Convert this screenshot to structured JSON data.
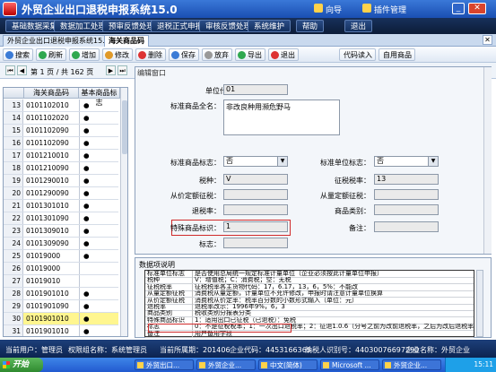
{
  "app": {
    "title": "外贸企业出口退税申报系统15.0",
    "wizard_label": "向导",
    "plugin_label": "插件管理"
  },
  "menu": [
    "基础数据采集",
    "数据加工处理",
    "预审反馈处理",
    "退税正式申报",
    "审核反馈处理",
    "系统维护",
    "帮助",
    "退出"
  ],
  "doc_tabs": {
    "first": "外贸企业出口退税申报系统15.0",
    "active": "海关商品码"
  },
  "toolbar": [
    "搜索",
    "刷新",
    "增加",
    "修改",
    "删除",
    "保存",
    "放弃",
    "导出",
    "退出",
    "代码读入",
    "自用商品"
  ],
  "pager": {
    "page_text": "第 1 页 / 共 162 页"
  },
  "grid": {
    "headers": [
      "海关商品码",
      "基本商品标志"
    ],
    "rows": [
      {
        "n": "13",
        "code": "0101102010",
        "flag": "●"
      },
      {
        "n": "14",
        "code": "0101102020",
        "flag": "●"
      },
      {
        "n": "15",
        "code": "0101102090",
        "flag": "●"
      },
      {
        "n": "16",
        "code": "0101102090",
        "flag": "●"
      },
      {
        "n": "17",
        "code": "0101210010",
        "flag": "●"
      },
      {
        "n": "18",
        "code": "0101210090",
        "flag": "●"
      },
      {
        "n": "19",
        "code": "0101290010",
        "flag": "●"
      },
      {
        "n": "20",
        "code": "0101290090",
        "flag": "●"
      },
      {
        "n": "21",
        "code": "0101301010",
        "flag": "●"
      },
      {
        "n": "22",
        "code": "0101301090",
        "flag": "●"
      },
      {
        "n": "23",
        "code": "0101309010",
        "flag": "●"
      },
      {
        "n": "24",
        "code": "0101309090",
        "flag": "●"
      },
      {
        "n": "25",
        "code": "01019000",
        "flag": "●"
      },
      {
        "n": "26",
        "code": "01019000",
        "flag": ""
      },
      {
        "n": "27",
        "code": "01019010",
        "flag": ""
      },
      {
        "n": "28",
        "code": "0101901010",
        "flag": "●"
      },
      {
        "n": "29",
        "code": "0101901090",
        "flag": "●"
      },
      {
        "n": "30",
        "code": "0101901010",
        "flag": "●"
      },
      {
        "n": "31",
        "code": "0101901010",
        "flag": "●"
      },
      {
        "n": "32",
        "code": "0101901090",
        "flag": "●"
      }
    ],
    "selected_row": "30"
  },
  "edit": {
    "title": "编辑窗口",
    "unit_code_label": "单位代码：",
    "unit_code": "01",
    "std_name_label": "标准商品全名：",
    "std_name": "非改良种用濒危野马",
    "std_flag_label": "标准商品标志：",
    "std_flag": "否",
    "std_unit_flag_label": "标准单位标志：",
    "std_unit_flag": "否",
    "tax_type_label": "税种：",
    "tax_type": "V",
    "levy_rate_label": "征税税率：",
    "levy_rate": "13",
    "ad_valorem_label": "从价定额征税：",
    "ad_valorem": "",
    "specific_label": "从量定额征税：",
    "specific": "",
    "refund_rate_label": "退税率：",
    "refund_rate": "",
    "category_label": "商品类别：",
    "category": "",
    "special_flag_label": "特殊商品标识：",
    "special_flag": "1",
    "remark_label": "备注：",
    "remark": "",
    "mark_label": "标志：",
    "mark": ""
  },
  "desc": {
    "title": "数据项说明",
    "rows": [
      {
        "k": "标准单位标志",
        "v": "是否使用总局统一规定标准计量单位（企业必须按此计量单位申报）"
      },
      {
        "k": "税种",
        "v": "V：增值税；C：消费税；空：无税"
      },
      {
        "k": "征税税率",
        "v": "征税税率各主货物代码：17，6.17，13，6，5%：不能改"
      },
      {
        "k": "从量定额征税",
        "v": "消费税从量定额，计量单位不允许修改，申报时请注意计量单位换算"
      },
      {
        "k": "从价定额征税",
        "v": "消费税从价定率：税率百分数的小数形式输入（单位：元）"
      },
      {
        "k": "退税率",
        "v": "退税率改示：1996年9%，6，3"
      },
      {
        "k": "商品类别",
        "v": "税收类别分报表分类"
      },
      {
        "k": "特殊商品标识",
        "v": "1：适用出口已征税（已退税）：免税"
      },
      {
        "k": "标志",
        "v": "0：不是征税税率；1：一次出口退税率；2：征退1.0.6（分号之前为改前退税率，之后为改后退税率）"
      },
      {
        "k": "备注",
        "v": "用户备用字段"
      }
    ]
  },
  "status": {
    "user": "当前用户：管理员",
    "role": "权限组名称：系统管理员",
    "period": "当前所属期：201406",
    "ent_code": "企业代码：4453166365",
    "taxpayer": "纳税人识别号：44030076697290",
    "ent_name": "企业名称：外贸企业"
  },
  "taskbar": {
    "start": "开始",
    "items": [
      "外贸出口...",
      "外贸企业...",
      "中文(简体)",
      "Microsoft ...",
      "外贸企业..."
    ],
    "tray": "15:11"
  },
  "colors": {
    "title_bar": "#1a4fb2",
    "menu_bar": "#0c1c38",
    "status_bar": "#0c2450",
    "highlight": "#d02a2a",
    "selected_row": "#fff68f"
  }
}
